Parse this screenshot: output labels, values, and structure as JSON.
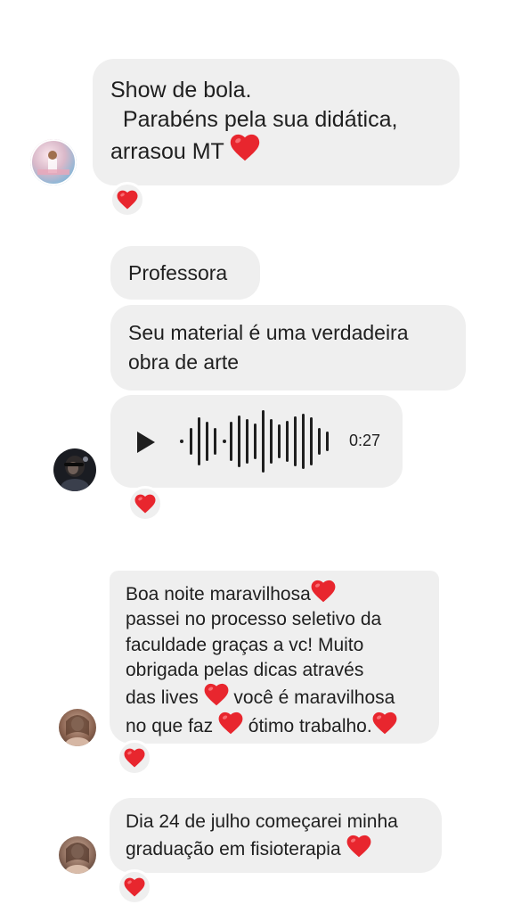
{
  "colors": {
    "bubble": "#efefef",
    "heart": "#e8262e",
    "text": "#1f1f1f"
  },
  "messages": [
    {
      "lines": [
        "Show de bola.",
        "  Parabéns pela sua didática,",
        "arrasou MT"
      ],
      "trailing_emoji": "heart"
    },
    {
      "text": "Professora"
    },
    {
      "lines": [
        "Seu material é uma verdadeira",
        "obra de arte"
      ]
    },
    {
      "type": "voice",
      "duration": "0:27",
      "play_icon": "play-icon"
    },
    {
      "lines": [
        "Boa noite maravilhosa",
        "passei no processo seletivo da",
        "faculdade graças a vc! Muito",
        "obrigada pelas dicas através",
        "das lives",
        "você é maravilhosa",
        "no que faz",
        "ótimo trabalho."
      ]
    },
    {
      "lines": [
        "Dia 24 de julho começarei minha",
        "graduação em fisioterapia"
      ]
    }
  ],
  "reactions": [
    "heart",
    "heart",
    "heart",
    "heart"
  ],
  "avatars": [
    "avatar-1",
    "avatar-2",
    "avatar-3",
    "avatar-4"
  ]
}
